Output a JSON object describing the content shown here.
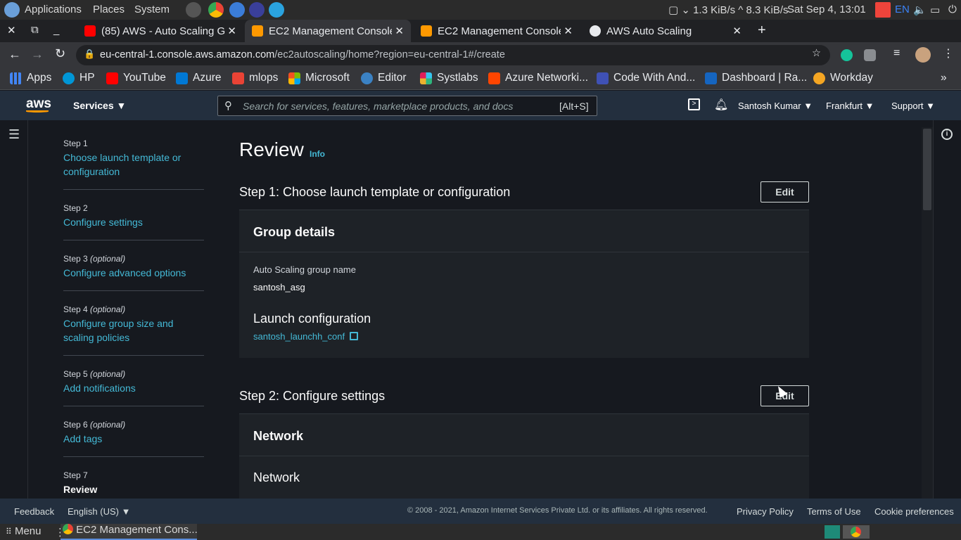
{
  "os": {
    "menu": [
      "Applications",
      "Places",
      "System"
    ],
    "net_down": "1.3 KiB/s",
    "net_up": "8.3 KiB/s",
    "datetime": "Sat Sep  4, 13:01",
    "lang": "EN"
  },
  "tabs": [
    {
      "title": "(85) AWS - Auto Scaling G",
      "color": "#ff0000"
    },
    {
      "title": "EC2 Management Console",
      "color": "#ff9900"
    },
    {
      "title": "EC2 Management Console",
      "color": "#ff9900"
    },
    {
      "title": "AWS Auto Scaling",
      "color": "#e8eaed"
    }
  ],
  "url": {
    "host": "eu-central-1.console.aws.amazon.com",
    "path": "/ec2autoscaling/home?region=eu-central-1#/create"
  },
  "bookmarks": [
    {
      "label": "Apps",
      "color": "#4285f4"
    },
    {
      "label": "HP",
      "color": "#0096d6"
    },
    {
      "label": "YouTube",
      "color": "#ff0000"
    },
    {
      "label": "Azure",
      "color": "#0078d4"
    },
    {
      "label": "mlops",
      "color": "#ea4335"
    },
    {
      "label": "Microsoft",
      "color": "#f25022"
    },
    {
      "label": "Editor",
      "color": "#3b82c4"
    },
    {
      "label": "Systlabs",
      "color": "#36c5f0"
    },
    {
      "label": "Azure Networki...",
      "color": "#ff4500"
    },
    {
      "label": "Code With And...",
      "color": "#3f51b5"
    },
    {
      "label": "Dashboard | Ra...",
      "color": "#1565c0"
    },
    {
      "label": "Workday",
      "color": "#f5a623"
    }
  ],
  "aws": {
    "services": "Services",
    "search_placeholder": "Search for services, features, marketplace products, and docs",
    "shortcut": "[Alt+S]",
    "user": "Santosh Kumar",
    "region": "Frankfurt",
    "support": "Support"
  },
  "steps": [
    {
      "no": "Step 1",
      "opt": "",
      "label": "Choose launch template or configuration"
    },
    {
      "no": "Step 2",
      "opt": "",
      "label": "Configure settings"
    },
    {
      "no": "Step 3",
      "opt": "(optional)",
      "label": "Configure advanced options"
    },
    {
      "no": "Step 4",
      "opt": "(optional)",
      "label": "Configure group size and scaling policies"
    },
    {
      "no": "Step 5",
      "opt": "(optional)",
      "label": "Add notifications"
    },
    {
      "no": "Step 6",
      "opt": "(optional)",
      "label": "Add tags"
    },
    {
      "no": "Step 7",
      "opt": "",
      "label": "Review"
    }
  ],
  "review": {
    "title": "Review",
    "info": "Info",
    "step1_title": "Step 1: Choose launch template or configuration",
    "edit": "Edit",
    "group_details": "Group details",
    "asg_name_label": "Auto Scaling group name",
    "asg_name": "santosh_asg",
    "launch_config_label": "Launch configuration",
    "launch_config_value": "santosh_launchh_conf",
    "step2_title": "Step 2: Configure settings",
    "network_header": "Network",
    "network_label": "Network"
  },
  "footer": {
    "feedback": "Feedback",
    "language": "English (US)",
    "copyright": "© 2008 - 2021, Amazon Internet Services Private Ltd. or its affiliates. All rights reserved.",
    "privacy": "Privacy Policy",
    "terms": "Terms of Use",
    "cookies": "Cookie preferences"
  },
  "taskbar": {
    "menu": "Menu",
    "window": "EC2 Management Cons..."
  }
}
